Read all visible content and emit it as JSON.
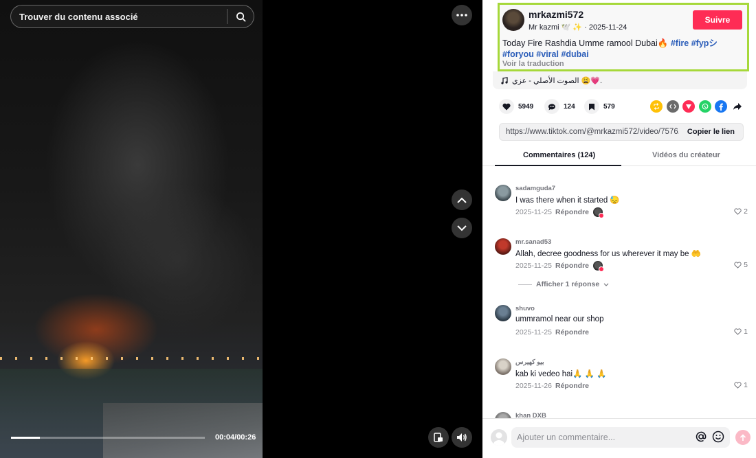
{
  "search": {
    "placeholder": "Trouver du contenu associé"
  },
  "player": {
    "time": "00:04/00:26",
    "progress": 0.15
  },
  "creator": {
    "username": "mrkazmi572",
    "nickname": "Mr kazmi 🕊️ ✨",
    "date": "2025-11-24",
    "follow_label": "Suivre",
    "description_text": "Today Fire Rashdia Umme ramool Dubai🔥 ",
    "hashtags_line1": "#fire #fypシ",
    "hashtags_line2": "#foryou #viral #dubai",
    "translate_label": "Voir la traduction"
  },
  "music": {
    "title": "الصوت الأصلي - عزي 😩💗."
  },
  "stats": {
    "likes": "5949",
    "comments": "124",
    "saves": "579"
  },
  "link": {
    "url": "https://www.tiktok.com/@mrkazmi572/video/7576...",
    "copy_label": "Copier le lien"
  },
  "tabs": {
    "comments": "Commentaires (124)",
    "creator_videos": "Vidéos du créateur"
  },
  "comments": [
    {
      "user": "sadamguda7",
      "text": "I was there when it started 😓",
      "date": "2025-11-25",
      "reply": "Répondre",
      "likes": "2"
    },
    {
      "user": "mr.sanad53",
      "text": "Allah, decree goodness for us wherever it may be 🤲",
      "date": "2025-11-25",
      "reply": "Répondre",
      "likes": "5"
    },
    {
      "user": "shuvo",
      "text": "ummramol near our shop",
      "date": "2025-11-25",
      "reply": "Répondre",
      "likes": "1"
    },
    {
      "user": "بیو کھیرس",
      "text": "kab ki vedeo hai🙏 🙏 🙏",
      "date": "2025-11-26",
      "reply": "Répondre",
      "likes": "1"
    },
    {
      "user": "khan DXB"
    }
  ],
  "more_replies": "Afficher 1 réponse",
  "comment_input": {
    "placeholder": "Ajouter un commentaire..."
  },
  "colors": {
    "accent": "#fe2c55",
    "highlight": "#a6d83a",
    "hashtag": "#2b5db9"
  }
}
